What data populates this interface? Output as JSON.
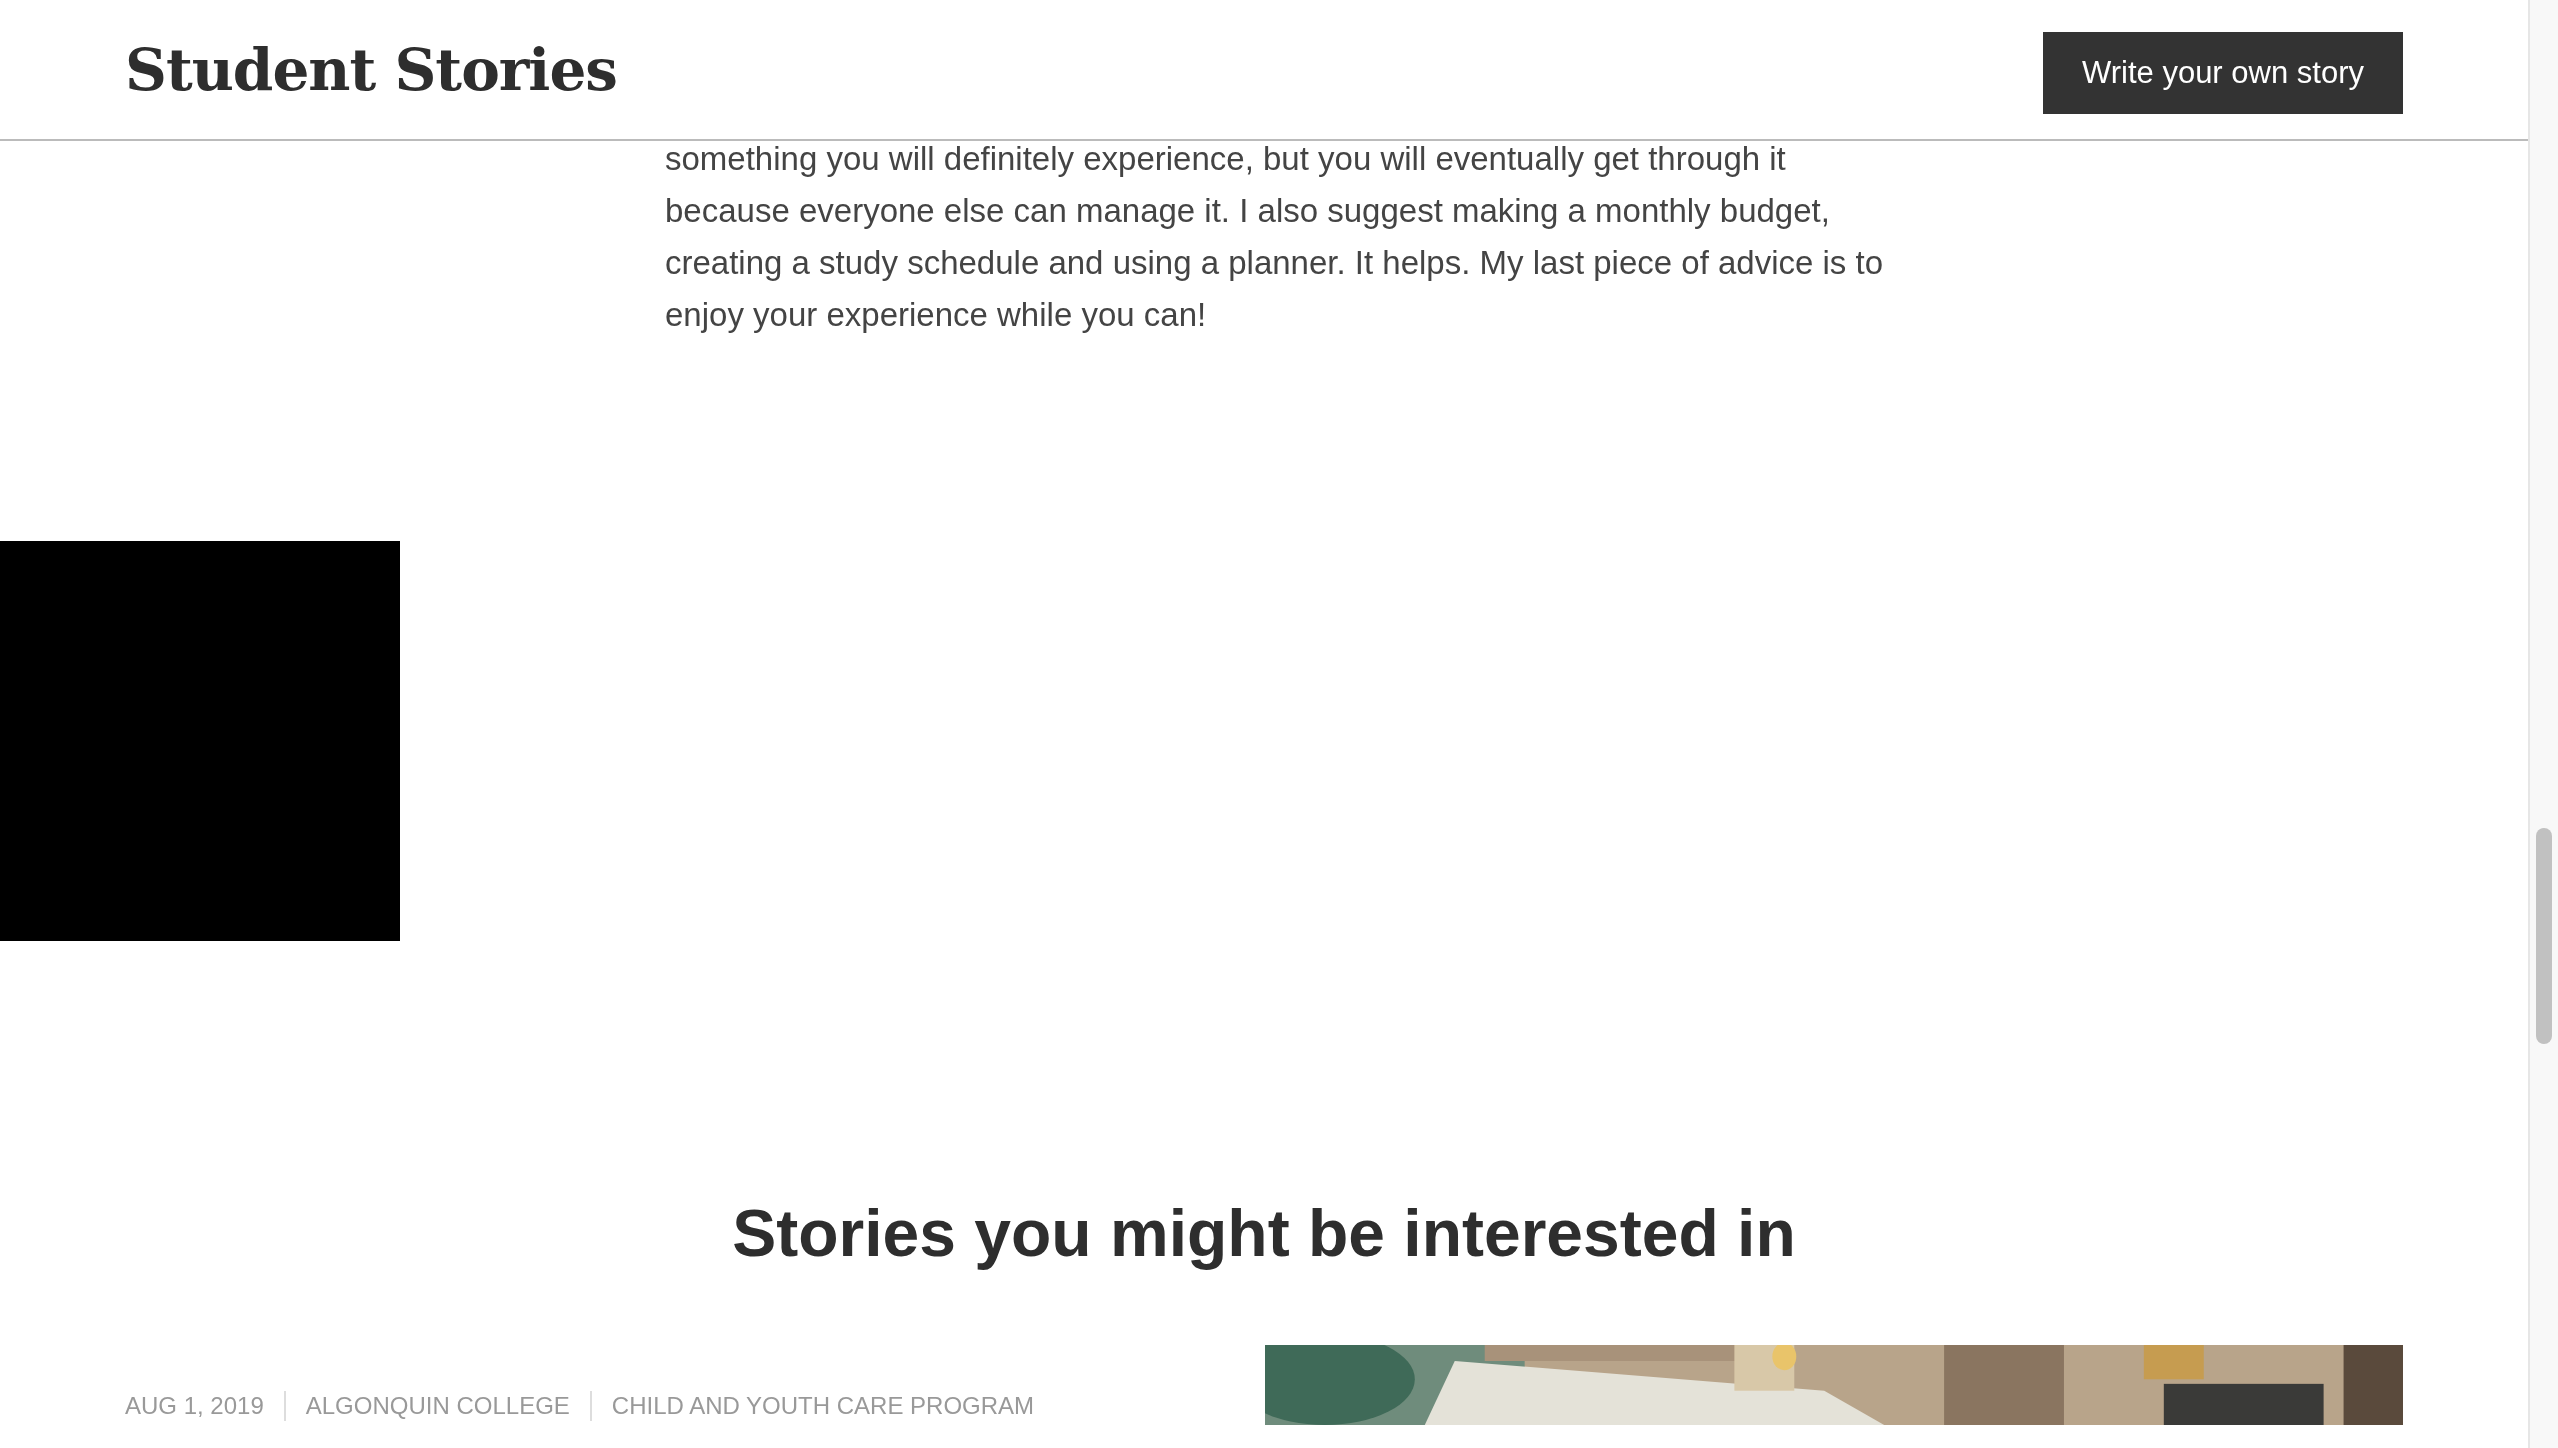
{
  "header": {
    "site_title": "Student Stories",
    "cta_button": "Write your own story"
  },
  "story_text": "something you will definitely experience, but you will eventually get through it because everyone else can manage it. I also suggest making a monthly budget, creating a study schedule and using a planner. It helps. My last piece of advice is to enjoy your experience while you can!",
  "related": {
    "heading": "Stories you might be interested in",
    "stories": [
      {
        "meta": [
          "AUG 1, 2019",
          "ALGONQUIN COLLEGE",
          "CHILD AND YOUTH CARE PROGRAM"
        ]
      }
    ]
  }
}
